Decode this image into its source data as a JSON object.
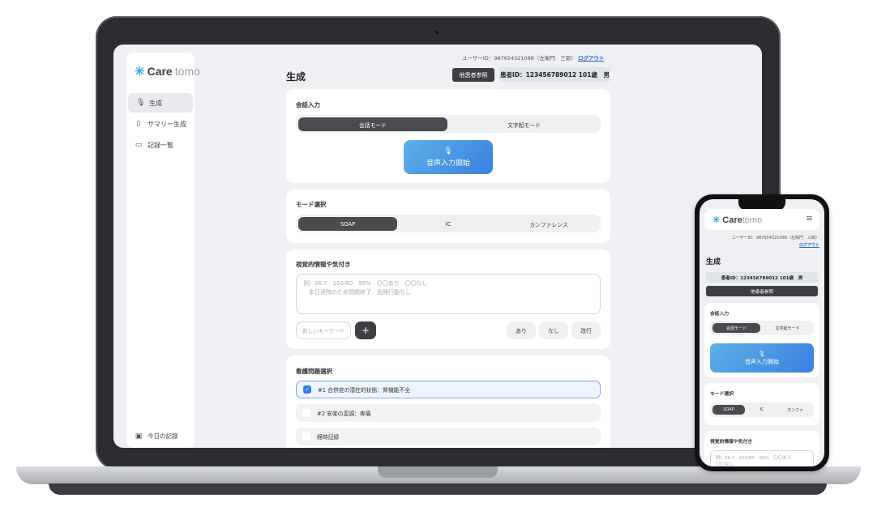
{
  "laptop": {
    "sidebar": {
      "logo_strong": "Care",
      "logo_light": "tomo",
      "items": [
        {
          "label": "生成",
          "icon": "mic-icon"
        },
        {
          "label": "サマリー生成",
          "icon": "clipboard-icon"
        },
        {
          "label": "記録一覧",
          "icon": "folder-icon"
        }
      ],
      "footer_label": "今日の記録"
    },
    "header": {
      "user_text": "ユーザーID：987654321098（左衛門　三郎）",
      "logout_label": "ログアウト",
      "title": "生成",
      "other_patient_label": "他患者参照",
      "patient_info": "患者ID：123456789012  101歳　男"
    },
    "conversation_card": {
      "title": "会話入力",
      "modes": [
        "会話モード",
        "文字起モード"
      ],
      "selected_mode": "会話モード",
      "voice_button_label": "音声入力開始"
    },
    "mode_card": {
      "title": "モード選択",
      "options": [
        "SOAP",
        "IC",
        "カンファレンス"
      ],
      "selected": "SOAP"
    },
    "observation_card": {
      "title": "視覚的情報や気付き",
      "placeholder": "例）36.7　150/80　99%　〇〇あり　〇〇なし\n　本日退院のため問題終了　危険行動なし",
      "keyword_placeholder": "新しいキーワード",
      "add_label": "+",
      "chips": [
        "あり",
        "なし",
        "改行"
      ]
    },
    "issues_card": {
      "title": "看護問題選択",
      "items": [
        {
          "label": "#1 合併症の潜在的状態：腎機能不全",
          "checked": true
        },
        {
          "label": "#2 安楽の変調：疼痛",
          "checked": false
        },
        {
          "label": "経時記録",
          "checked": false
        }
      ]
    }
  },
  "phone": {
    "logo_strong": "Care",
    "logo_light": "tomo",
    "menu_icon": "hamburger-icon",
    "user_text": "ユーザーID：987654321098（左衛門　三郎）",
    "logout_label": "ログアウト",
    "title": "生成",
    "patient_info": "患者ID：123456789012  101歳　男",
    "other_patient_label": "他患者参照",
    "conversation_title": "会話入力",
    "modes": [
      "会話モード",
      "文字起モード"
    ],
    "voice_button_label": "音声入力開始",
    "mode_title": "モード選択",
    "mode_options": [
      "SOAP",
      "IC",
      "カンファ"
    ],
    "observation_title": "視覚的情報や気付き",
    "observation_placeholder": "例）36.7　150/80　99%　〇〇あり\n〇〇なし"
  },
  "colors": {
    "accent": "#3a7fe0",
    "dark_button": "#3e3f43",
    "logo_spark": "#39a6e8"
  }
}
